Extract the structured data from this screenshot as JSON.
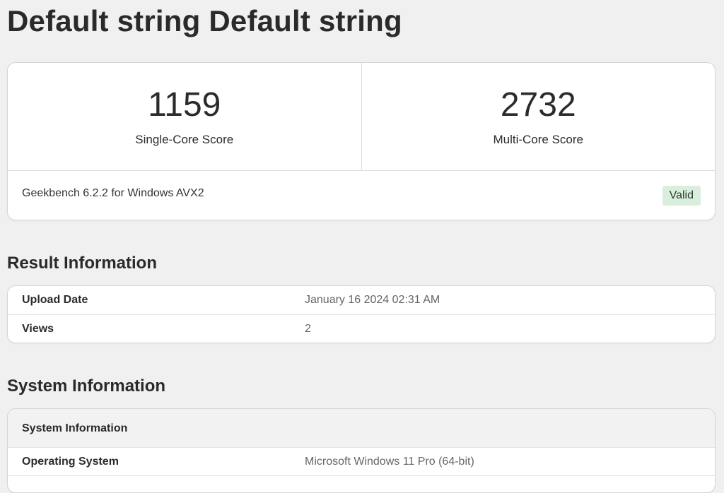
{
  "page": {
    "title": "Default string Default string"
  },
  "scores": {
    "single_core": {
      "value": "1159",
      "label": "Single-Core Score"
    },
    "multi_core": {
      "value": "2732",
      "label": "Multi-Core Score"
    },
    "version": "Geekbench 6.2.2 for Windows AVX2",
    "status_badge": "Valid"
  },
  "result_info": {
    "heading": "Result Information",
    "rows": [
      {
        "key": "Upload Date",
        "value": "January 16 2024 02:31 AM"
      },
      {
        "key": "Views",
        "value": "2"
      }
    ]
  },
  "system_info": {
    "heading": "System Information",
    "table_header": "System Information",
    "rows": [
      {
        "key": "Operating System",
        "value": "Microsoft Windows 11 Pro (64-bit)"
      }
    ]
  },
  "colors": {
    "background": "#f0f0f0",
    "card": "#ffffff",
    "valid_badge_bg": "#d9eedd"
  }
}
